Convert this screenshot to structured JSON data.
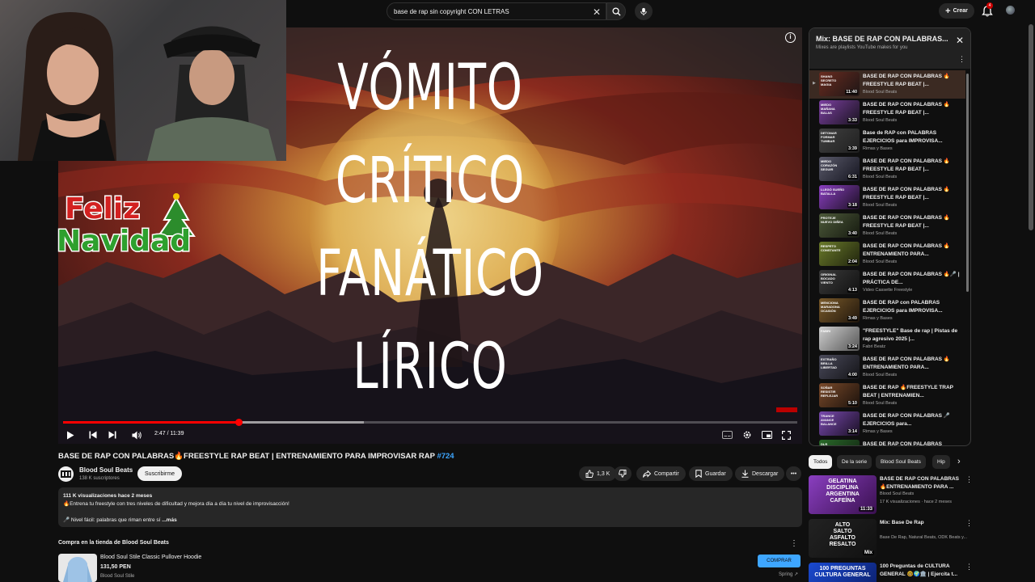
{
  "search": {
    "query": "base de rap sin copyright CON LETRAS"
  },
  "header": {
    "create_label": "Crear",
    "notif_count": "4"
  },
  "video": {
    "lyrics": [
      "VÓMITO",
      "CRÍTICO",
      "FANÁTICO",
      "LÍRICO"
    ],
    "time": "2:47 / 11:39",
    "progress_fraction": 0.239,
    "buffer_fraction": 0.41,
    "overlay_text": [
      "Feliz",
      "Navidad"
    ]
  },
  "watch": {
    "title": "BASE DE RAP CON PALABRAS🔥FREESTYLE RAP BEAT | ENTRENAMIENTO PARA IMPROVISAR RAP",
    "hashtag": "#724",
    "channel": "Blood Soul Beats",
    "subs": "138 K suscriptores",
    "subscribe": "Suscribirme",
    "likes": "1,3 K",
    "share": "Compartir",
    "save": "Guardar",
    "download": "Descargar",
    "desc_views": "111 K visualizaciones  hace 2 meses",
    "desc_line1": "🔥Entrena tu freestyle con tres niveles de dificultad y mejora día a día tu nivel de improvisacción!",
    "desc_line2": "🎤 Nivel fácil: palabras que riman entre sí",
    "desc_more": "...más"
  },
  "store": {
    "heading": "Compra en la tienda de Blood Soul Beats",
    "product": "Blood Soul Stile Classic Pullover Hoodie",
    "price": "131,50 PEN",
    "seller": "Blood Soul Stile",
    "buy": "COMPRAR",
    "spring": "Spring"
  },
  "playlist": {
    "title": "Mix: BASE DE RAP CON PALABRAS...",
    "subtitle": "Mixes are playlists YouTube makes for you",
    "items": [
      {
        "title": "BASE DE RAP CON PALABRAS 🔥FREESTYLE RAP BEAT |...",
        "channel": "Blood Soul Beats",
        "dur": "11:40"
      },
      {
        "title": "BASE DE RAP CON PALABRAS 🔥FREESTYLE RAP BEAT |...",
        "channel": "Blood Soul Beats",
        "dur": "3:33"
      },
      {
        "title": "Base de RAP con PALABRAS EJERCICIOS para IMPROVISA...",
        "channel": "Rimas y Bases",
        "dur": "3:39"
      },
      {
        "title": "BASE DE RAP CON PALABRAS 🔥FREESTYLE RAP BEAT |...",
        "channel": "Blood Soul Beats",
        "dur": "6:31"
      },
      {
        "title": "BASE DE RAP CON PALABRAS 🔥FREESTYLE RAP BEAT |...",
        "channel": "Blood Soul Beats",
        "dur": "3:18"
      },
      {
        "title": "BASE DE RAP CON PALABRAS 🔥FREESTYLE RAP BEAT |...",
        "channel": "Blood Soul Beats",
        "dur": "3:40"
      },
      {
        "title": "BASE DE RAP CON PALABRAS 🔥ENTRENAMIENTO PARA...",
        "channel": "Blood Soul Beats",
        "dur": "2:04"
      },
      {
        "title": "BASE DE RAP CON PALABRAS 🔥🎤 | PRÁCTICA DE...",
        "channel": "Video Cassette Freestyle",
        "dur": "4:13"
      },
      {
        "title": "BASE DE RAP con PALABRAS EJERCICIOS para IMPROVISA...",
        "channel": "Rimas y Bases",
        "dur": "3:49"
      },
      {
        "title": "\"FREESTYLE\" Base de rap | Pistas de rap agresivo 2025 |...",
        "channel": "Fabri Beatz",
        "dur": "3:24"
      },
      {
        "title": "BASE DE RAP CON PALABRAS 🔥ENTRENAMIENTO PARA...",
        "channel": "Blood Soul Beats",
        "dur": "4:00"
      },
      {
        "title": "BASE DE RAP 🔥FREESTYLE TRAP BEAT | ENTRENAMIEN...",
        "channel": "Blood Soul Beats",
        "dur": "5:10"
      },
      {
        "title": "BASE DE RAP CON PALABRAS 🎤 EJERCICIOS para...",
        "channel": "Rimas y Bases",
        "dur": "3:14"
      },
      {
        "title": "BASE DE RAP CON PALABRAS",
        "channel": "",
        "dur": ""
      }
    ],
    "thumb_words": [
      "SHANG SECRETO MAGIA",
      "MIEDO MAÑANA BALAS",
      "DETONAR FORMAR TUMBAR",
      "MIEDO CORAZÓN SEGUIR",
      "LLEGÓ SUEÑO BATALLA",
      "PROTEJE NUEVO DIÑEA",
      "RESPETO CONSTANTE",
      "ORIGINAL BOCADO VIENTO",
      "MENCIONA MARADONA OCASIÓN",
      "FABRI",
      "EXTRAÑO BRILLA LIBERTAD",
      "SOÑAR RESISTIR REFLEJAR",
      "TRANCE AVANCE BALANCE",
      "DLR"
    ]
  },
  "chips": [
    "Todos",
    "De la serie",
    "Blood Soul Beats",
    "Hip"
  ],
  "recs": [
    {
      "title": "BASE DE RAP CON PALABRAS 🔥ENTRENAMIENTO PARA ...",
      "channel": "Blood Soul Beats",
      "meta": "17 K visualizaciones · hace 2 meses",
      "badge": "11:33",
      "thumb": [
        "GELATINA",
        "DISCIPLINA",
        "ARGENTINA",
        "CAFEÍNA"
      ]
    },
    {
      "title": "Mix: Base De Rap",
      "channel": "Base De Rap, Natural Beats, ODK Beats y...",
      "meta": "",
      "badge": "Mix",
      "thumb": [
        "ALTO",
        "SALTO",
        "ASFALTO",
        "RESALTO"
      ]
    },
    {
      "title": "100 Preguntas de CULTURA GENERAL 🤓🌍🏛️ | Ejercita t...",
      "channel": "",
      "meta": "",
      "badge": "",
      "thumb": [
        "100 PREGUNTAS",
        "CULTURA GENERAL"
      ]
    }
  ],
  "colors": {
    "accent_red": "#ff0000",
    "link_blue": "#3ea6ff",
    "bg": "#0f0f0f"
  }
}
